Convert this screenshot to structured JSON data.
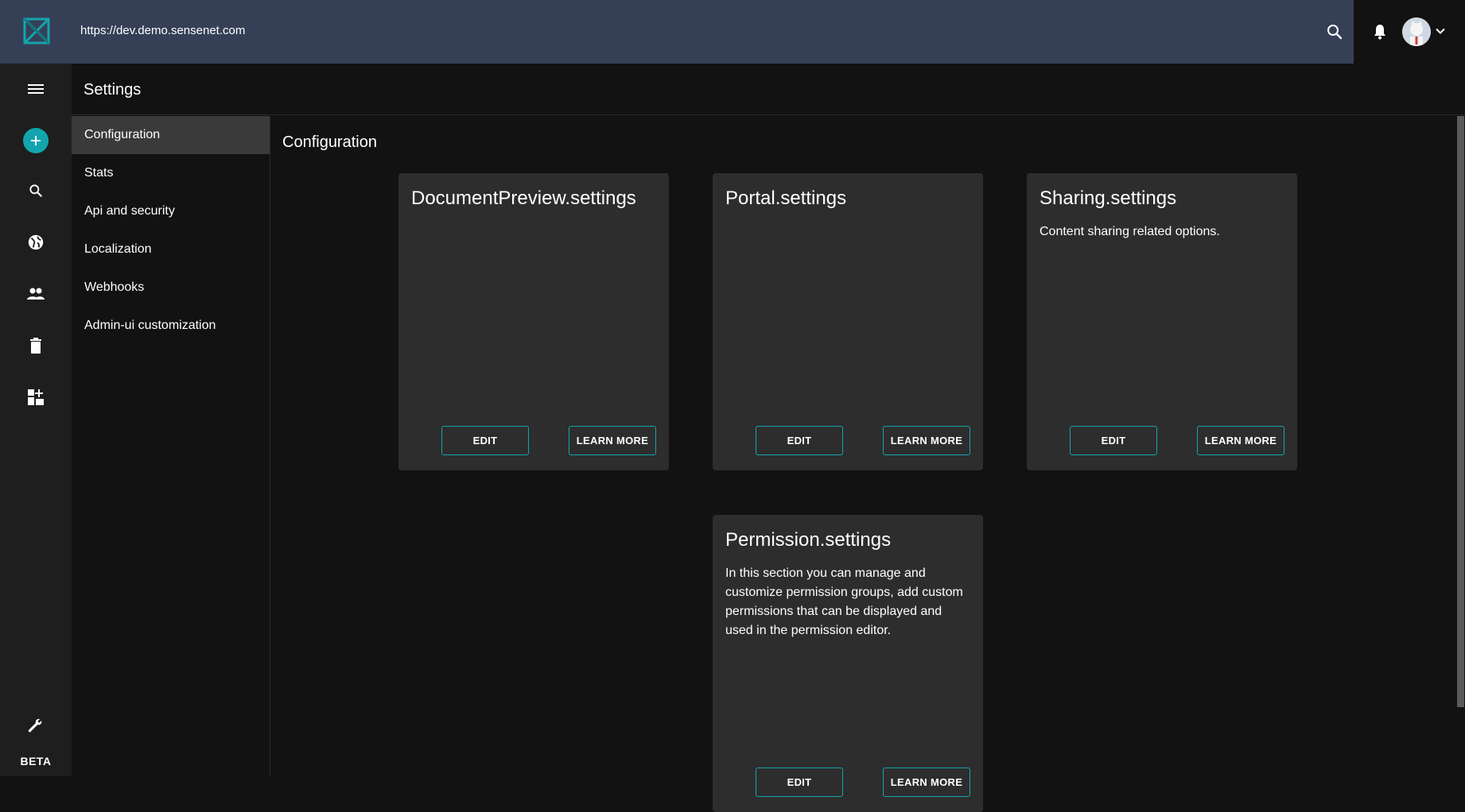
{
  "topbar": {
    "url": "https://dev.demo.sensenet.com",
    "logo_icon": "sensenet-logo",
    "search_icon": "search-icon",
    "bell_icon": "bell-icon",
    "avatar_icon": "avatar-icon",
    "chevron_icon": "chevron-down-icon",
    "bar_color": "#354057"
  },
  "leftrail": {
    "items": [
      "menu-icon",
      "add-icon",
      "search-icon",
      "globe-icon",
      "users-icon",
      "trash-icon",
      "dashboard-add-icon",
      "wrench-icon"
    ],
    "beta_label": "BETA",
    "accent_color": "#13a5ad"
  },
  "header": {
    "title": "Settings"
  },
  "subnav": {
    "items": [
      {
        "label": "Configuration",
        "active": true
      },
      {
        "label": "Stats"
      },
      {
        "label": "Api and security"
      },
      {
        "label": "Localization"
      },
      {
        "label": "Webhooks"
      },
      {
        "label": "Admin-ui customization"
      }
    ]
  },
  "content": {
    "title": "Configuration",
    "cards": [
      {
        "title": "DocumentPreview.settings",
        "description": "",
        "edit_label": "EDIT",
        "learn_label": "LEARN MORE"
      },
      {
        "title": "Portal.settings",
        "description": "",
        "edit_label": "EDIT",
        "learn_label": "LEARN MORE"
      },
      {
        "title": "Sharing.settings",
        "description": "Content sharing related options.",
        "edit_label": "EDIT",
        "learn_label": "LEARN MORE"
      },
      {
        "title": "Permission.settings",
        "description": "In this section you can manage and customize permission groups, add custom permissions that can be displayed and used in the permission editor.",
        "edit_label": "EDIT",
        "learn_label": "LEARN MORE"
      }
    ]
  }
}
